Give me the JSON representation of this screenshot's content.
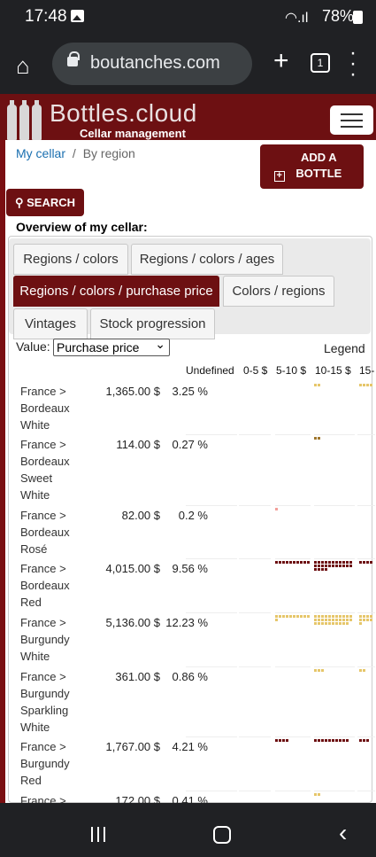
{
  "status": {
    "time": "17:48",
    "battery": "78%"
  },
  "browser": {
    "url": "boutanches.com",
    "tab_count": "1"
  },
  "brand": {
    "name": "Bottles.cloud",
    "subtitle": "Cellar management"
  },
  "breadcrumb": {
    "home": "My cellar",
    "separator": "/",
    "current": "By region"
  },
  "buttons": {
    "add_bottle": "ADD A BOTTLE",
    "search": "SEARCH"
  },
  "overview_title": "Overview of my cellar:",
  "tabs": [
    {
      "label": "Regions / colors",
      "active": false
    },
    {
      "label": "Regions / colors / ages",
      "active": false
    },
    {
      "label": "Regions / colors / purchase price",
      "active": true
    },
    {
      "label": "Colors / regions",
      "active": false
    },
    {
      "label": "Vintages",
      "active": false
    },
    {
      "label": "Stock progression",
      "active": false
    }
  ],
  "value_label": "Value:",
  "value_select": "Purchase price",
  "legend_label": "Legend",
  "columns": [
    "Undefined",
    "0-5 $",
    "5-10 $",
    "10-15 $",
    "15-"
  ],
  "colors": {
    "red": "#6d1012",
    "white": "#e6c66a",
    "rose": "#f3a09a",
    "sweet": "#a0772e"
  },
  "rows": [
    {
      "region": [
        "France >",
        "Bordeaux",
        "White"
      ],
      "amount": "1,365.00 $",
      "pct": "3.25 %",
      "color": "white",
      "counts": [
        0,
        0,
        0,
        2,
        4
      ]
    },
    {
      "region": [
        "France >",
        "Bordeaux",
        "Sweet",
        "White"
      ],
      "amount": "114.00 $",
      "pct": "0.27 %",
      "color": "sweet",
      "counts": [
        0,
        0,
        0,
        2,
        0
      ]
    },
    {
      "region": [
        "France >",
        "Bordeaux",
        "Rosé"
      ],
      "amount": "82.00 $",
      "pct": "0.2 %",
      "color": "rose",
      "counts": [
        0,
        0,
        1,
        0,
        0
      ]
    },
    {
      "region": [
        "France >",
        "Bordeaux",
        "Red"
      ],
      "amount": "4,015.00 $",
      "pct": "9.56 %",
      "color": "red",
      "counts": [
        0,
        0,
        10,
        26,
        4
      ]
    },
    {
      "region": [
        "France >",
        "Burgundy",
        "White"
      ],
      "amount": "5,136.00 $",
      "pct": "12.23 %",
      "color": "white",
      "counts": [
        0,
        0,
        11,
        32,
        9
      ]
    },
    {
      "region": [
        "France >",
        "Burgundy",
        "Sparkling",
        "White"
      ],
      "amount": "361.00 $",
      "pct": "0.86 %",
      "color": "white",
      "counts": [
        0,
        0,
        0,
        3,
        2
      ]
    },
    {
      "region": [
        "France >",
        "Burgundy",
        "Red"
      ],
      "amount": "1,767.00 $",
      "pct": "4.21 %",
      "color": "red",
      "counts": [
        0,
        0,
        4,
        10,
        3
      ]
    },
    {
      "region": [
        "France >"
      ],
      "amount": "172.00 $",
      "pct": "0.41 %",
      "color": "white",
      "counts": [
        0,
        0,
        0,
        2,
        0
      ]
    }
  ]
}
